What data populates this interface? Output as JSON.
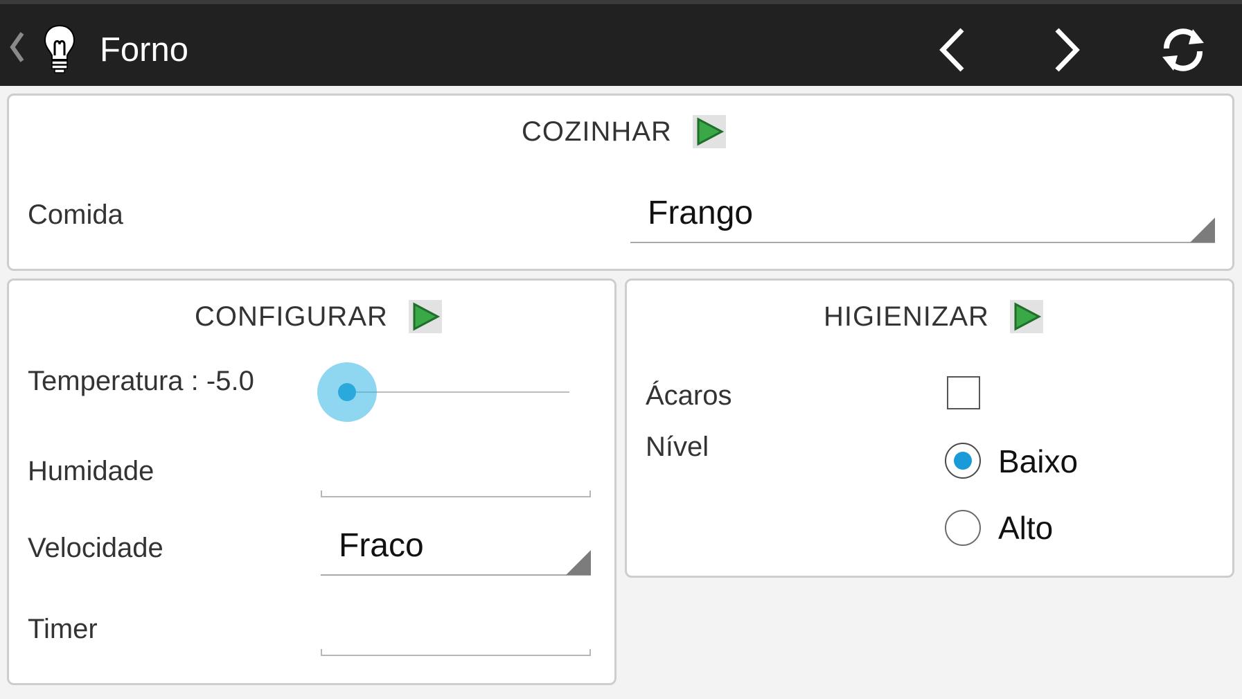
{
  "actionbar": {
    "title": "Forno",
    "up_icon": "chevron-left-icon",
    "app_icon": "lightbulb-icon",
    "prev_icon": "chevron-left-icon",
    "next_icon": "chevron-right-icon",
    "refresh_icon": "refresh-icon"
  },
  "cook": {
    "header": "COZINHAR",
    "play_icon": "play-icon",
    "food_label": "Comida",
    "food_value": "Frango"
  },
  "config": {
    "header": "CONFIGURAR",
    "play_icon": "play-icon",
    "temperature_label": "Temperatura : -5.0",
    "temperature_slider_fraction": 0.0,
    "humidity_label": "Humidade",
    "humidity_value": "",
    "speed_label": "Velocidade",
    "speed_value": "Fraco",
    "timer_label": "Timer",
    "timer_value": ""
  },
  "clean": {
    "header": "HIGIENIZAR",
    "play_icon": "play-icon",
    "mites_label": "Ácaros",
    "mites_checked": false,
    "level_label": "Nível",
    "level_options": [
      {
        "label": "Baixo",
        "checked": true
      },
      {
        "label": "Alto",
        "checked": false
      }
    ]
  },
  "colors": {
    "actionbar_bg": "#212121",
    "accent": "#33b5e5",
    "play_green": "#2e9e3e"
  }
}
